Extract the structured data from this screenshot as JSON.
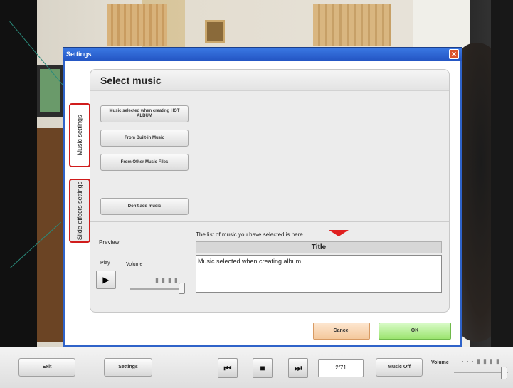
{
  "dialog": {
    "title": "Settings",
    "close_glyph": "✕",
    "heading": "Select music",
    "tabs": [
      {
        "label": "Music settings",
        "selected": true
      },
      {
        "label": "Slide effects settings",
        "selected": false
      }
    ],
    "music_buttons": [
      "Music selected when creating HOT ALBUM",
      "From Built-in Music",
      "From Other Music Files",
      "Don't add music"
    ],
    "preview_label": "Preview",
    "play_label": "Play",
    "play_glyph": "▶",
    "volume_label": "Volume",
    "volume_level": 1.0,
    "list_hint": "The list of music you have selected is here.",
    "list_header": "Title",
    "list_items": [
      "Music selected when creating album"
    ],
    "cancel_label": "Cancel",
    "ok_label": "OK",
    "accent_color": "#e02020"
  },
  "toolbar": {
    "exit_label": "Exit",
    "settings_label": "Settings",
    "prev_glyph": "⏮",
    "stop_glyph": "■",
    "next_glyph": "⏭",
    "counter": "2/71",
    "music_label": "Music Off",
    "volume_label": "Volume",
    "volume_level": 1.0
  }
}
